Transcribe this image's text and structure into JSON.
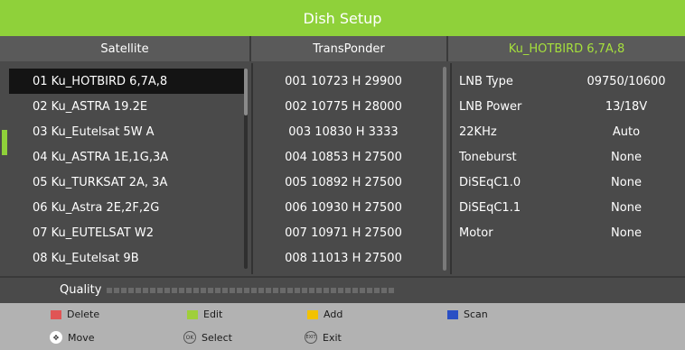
{
  "title": "Dish Setup",
  "headers": {
    "satellite": "Satellite",
    "transponder": "TransPonder",
    "lnb_title": "Ku_HOTBIRD 6,7A,8"
  },
  "satellites": [
    "01 Ku_HOTBIRD 6,7A,8",
    "02 Ku_ASTRA 19.2E",
    "03 Ku_Eutelsat 5W A",
    "04 Ku_ASTRA 1E,1G,3A",
    "05 Ku_TURKSAT 2A, 3A",
    "06 Ku_Astra 2E,2F,2G",
    "07 Ku_EUTELSAT W2",
    "08 Ku_Eutelsat 9B"
  ],
  "transponders": [
    "001 10723 H 29900",
    "002 10775 H 28000",
    "003 10830 H 3333",
    "004 10853 H 27500",
    "005 10892 H 27500",
    "006 10930 H 27500",
    "007 10971 H 27500",
    "008 11013 H 27500"
  ],
  "lnb_settings": [
    {
      "label": "LNB Type",
      "value": "09750/10600"
    },
    {
      "label": "LNB Power",
      "value": "13/18V"
    },
    {
      "label": "22KHz",
      "value": "Auto"
    },
    {
      "label": "Toneburst",
      "value": "None"
    },
    {
      "label": "DiSEqC1.0",
      "value": "None"
    },
    {
      "label": "DiSEqC1.1",
      "value": "None"
    },
    {
      "label": "Motor",
      "value": "None"
    }
  ],
  "quality": {
    "label": "Quality",
    "level": 0
  },
  "footer": {
    "delete": "Delete",
    "edit": "Edit",
    "add": "Add",
    "scan": "Scan",
    "move": "Move",
    "select": "Select",
    "exit": "Exit",
    "ok_icon_text": "OK",
    "exit_icon_text": "EXIT"
  },
  "icons": {
    "delete": "red-square-icon",
    "edit": "green-square-icon",
    "add": "yellow-square-icon",
    "scan": "blue-square-icon",
    "move": "navigation-pad-icon",
    "select": "ok-button-icon",
    "exit": "exit-button-icon"
  },
  "colors": {
    "accent": "#8fd13a",
    "lnb_title": "#a6e03c",
    "delete": "#e05555",
    "edit": "#9fcf3a",
    "add": "#f2c200",
    "scan": "#2a4fc4"
  },
  "selected_satellite": 0
}
